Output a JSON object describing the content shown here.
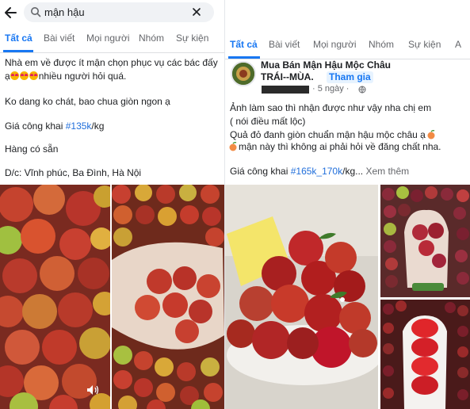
{
  "left": {
    "search": {
      "query": "mận hậu"
    },
    "tabs": [
      {
        "label": "Tất cả"
      },
      {
        "label": "Bài viết"
      },
      {
        "label": "Mọi người"
      },
      {
        "label": "Nhóm"
      },
      {
        "label": "Sự kiện"
      }
    ],
    "post": {
      "line1": "Nhà em về được ít mận chọn phục vụ các bác đấy",
      "line2_prefix": "ạ",
      "line2_suffix": "nhiều người hỏi quá.",
      "line3": "Ko dang ko chát, bao chua giòn ngon ạ",
      "price_prefix": "Giá công khai ",
      "price_tag": "#135k",
      "price_suffix": "/kg",
      "line5": "Hàng có sẵn",
      "address": "D/c: Vĩnh phúc, Ba Đình, Hà Nội"
    }
  },
  "right": {
    "tabs": [
      {
        "label": "Tất cả"
      },
      {
        "label": "Bài viết"
      },
      {
        "label": "Mọi người"
      },
      {
        "label": "Nhóm"
      },
      {
        "label": "Sự kiện"
      },
      {
        "label": "A"
      }
    ],
    "group": {
      "name_line1": "Mua Bán Mận Hậu Mộc Châu",
      "name_line2": "TRÁI--MÙA.",
      "join": "Tham gia",
      "time": "· 5 ngày ·"
    },
    "post": {
      "line1": "Ảnh làm sao thì nhận được như vậy nha chị em",
      "line2": "( nói điều mất lộc)",
      "line3": "Quả đỏ đanh giòn chuẩn mận hậu mộc châu ạ",
      "line4": "mận này thì không ai phải hỏi về đăng chất nha.",
      "price_prefix": "Giá công khai ",
      "price_tag": "#165k_170k",
      "price_suffix": "/kg... ",
      "see_more": "Xem thêm"
    }
  },
  "colors": {
    "accent": "#1877f2",
    "hashtag": "#216fdb",
    "muted": "#65676b",
    "plum_red": "#c0392b",
    "plum_yellow": "#d9a92a"
  }
}
